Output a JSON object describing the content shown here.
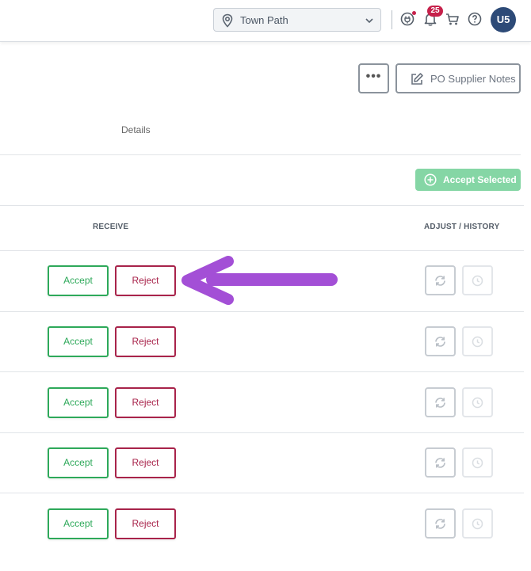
{
  "header": {
    "location": "Town Path",
    "notifications_count": "25",
    "avatar_initials": "U5",
    "icons": [
      "location-pin-icon",
      "chevron-down-icon",
      "plug-icon",
      "bell-icon",
      "cart-icon",
      "help-icon"
    ]
  },
  "actions": {
    "more_label": "•••",
    "supplier_notes_label": "PO Supplier Notes"
  },
  "details_label": "Details",
  "accept_selected_label": "Accept Selected",
  "columns": {
    "receive": "RECEIVE",
    "adjust_history": "ADJUST / HISTORY"
  },
  "rows": [
    {
      "accept": "Accept",
      "reject": "Reject"
    },
    {
      "accept": "Accept",
      "reject": "Reject"
    },
    {
      "accept": "Accept",
      "reject": "Reject"
    },
    {
      "accept": "Accept",
      "reject": "Reject"
    },
    {
      "accept": "Accept",
      "reject": "Reject"
    }
  ],
  "colors": {
    "accept_green": "#2ea95a",
    "reject_red": "#a8234a",
    "accept_selected_bg": "#85d6a5",
    "annotation_arrow": "#a34fd6",
    "avatar_bg": "#2d4a77",
    "badge_red": "#c6214b"
  }
}
